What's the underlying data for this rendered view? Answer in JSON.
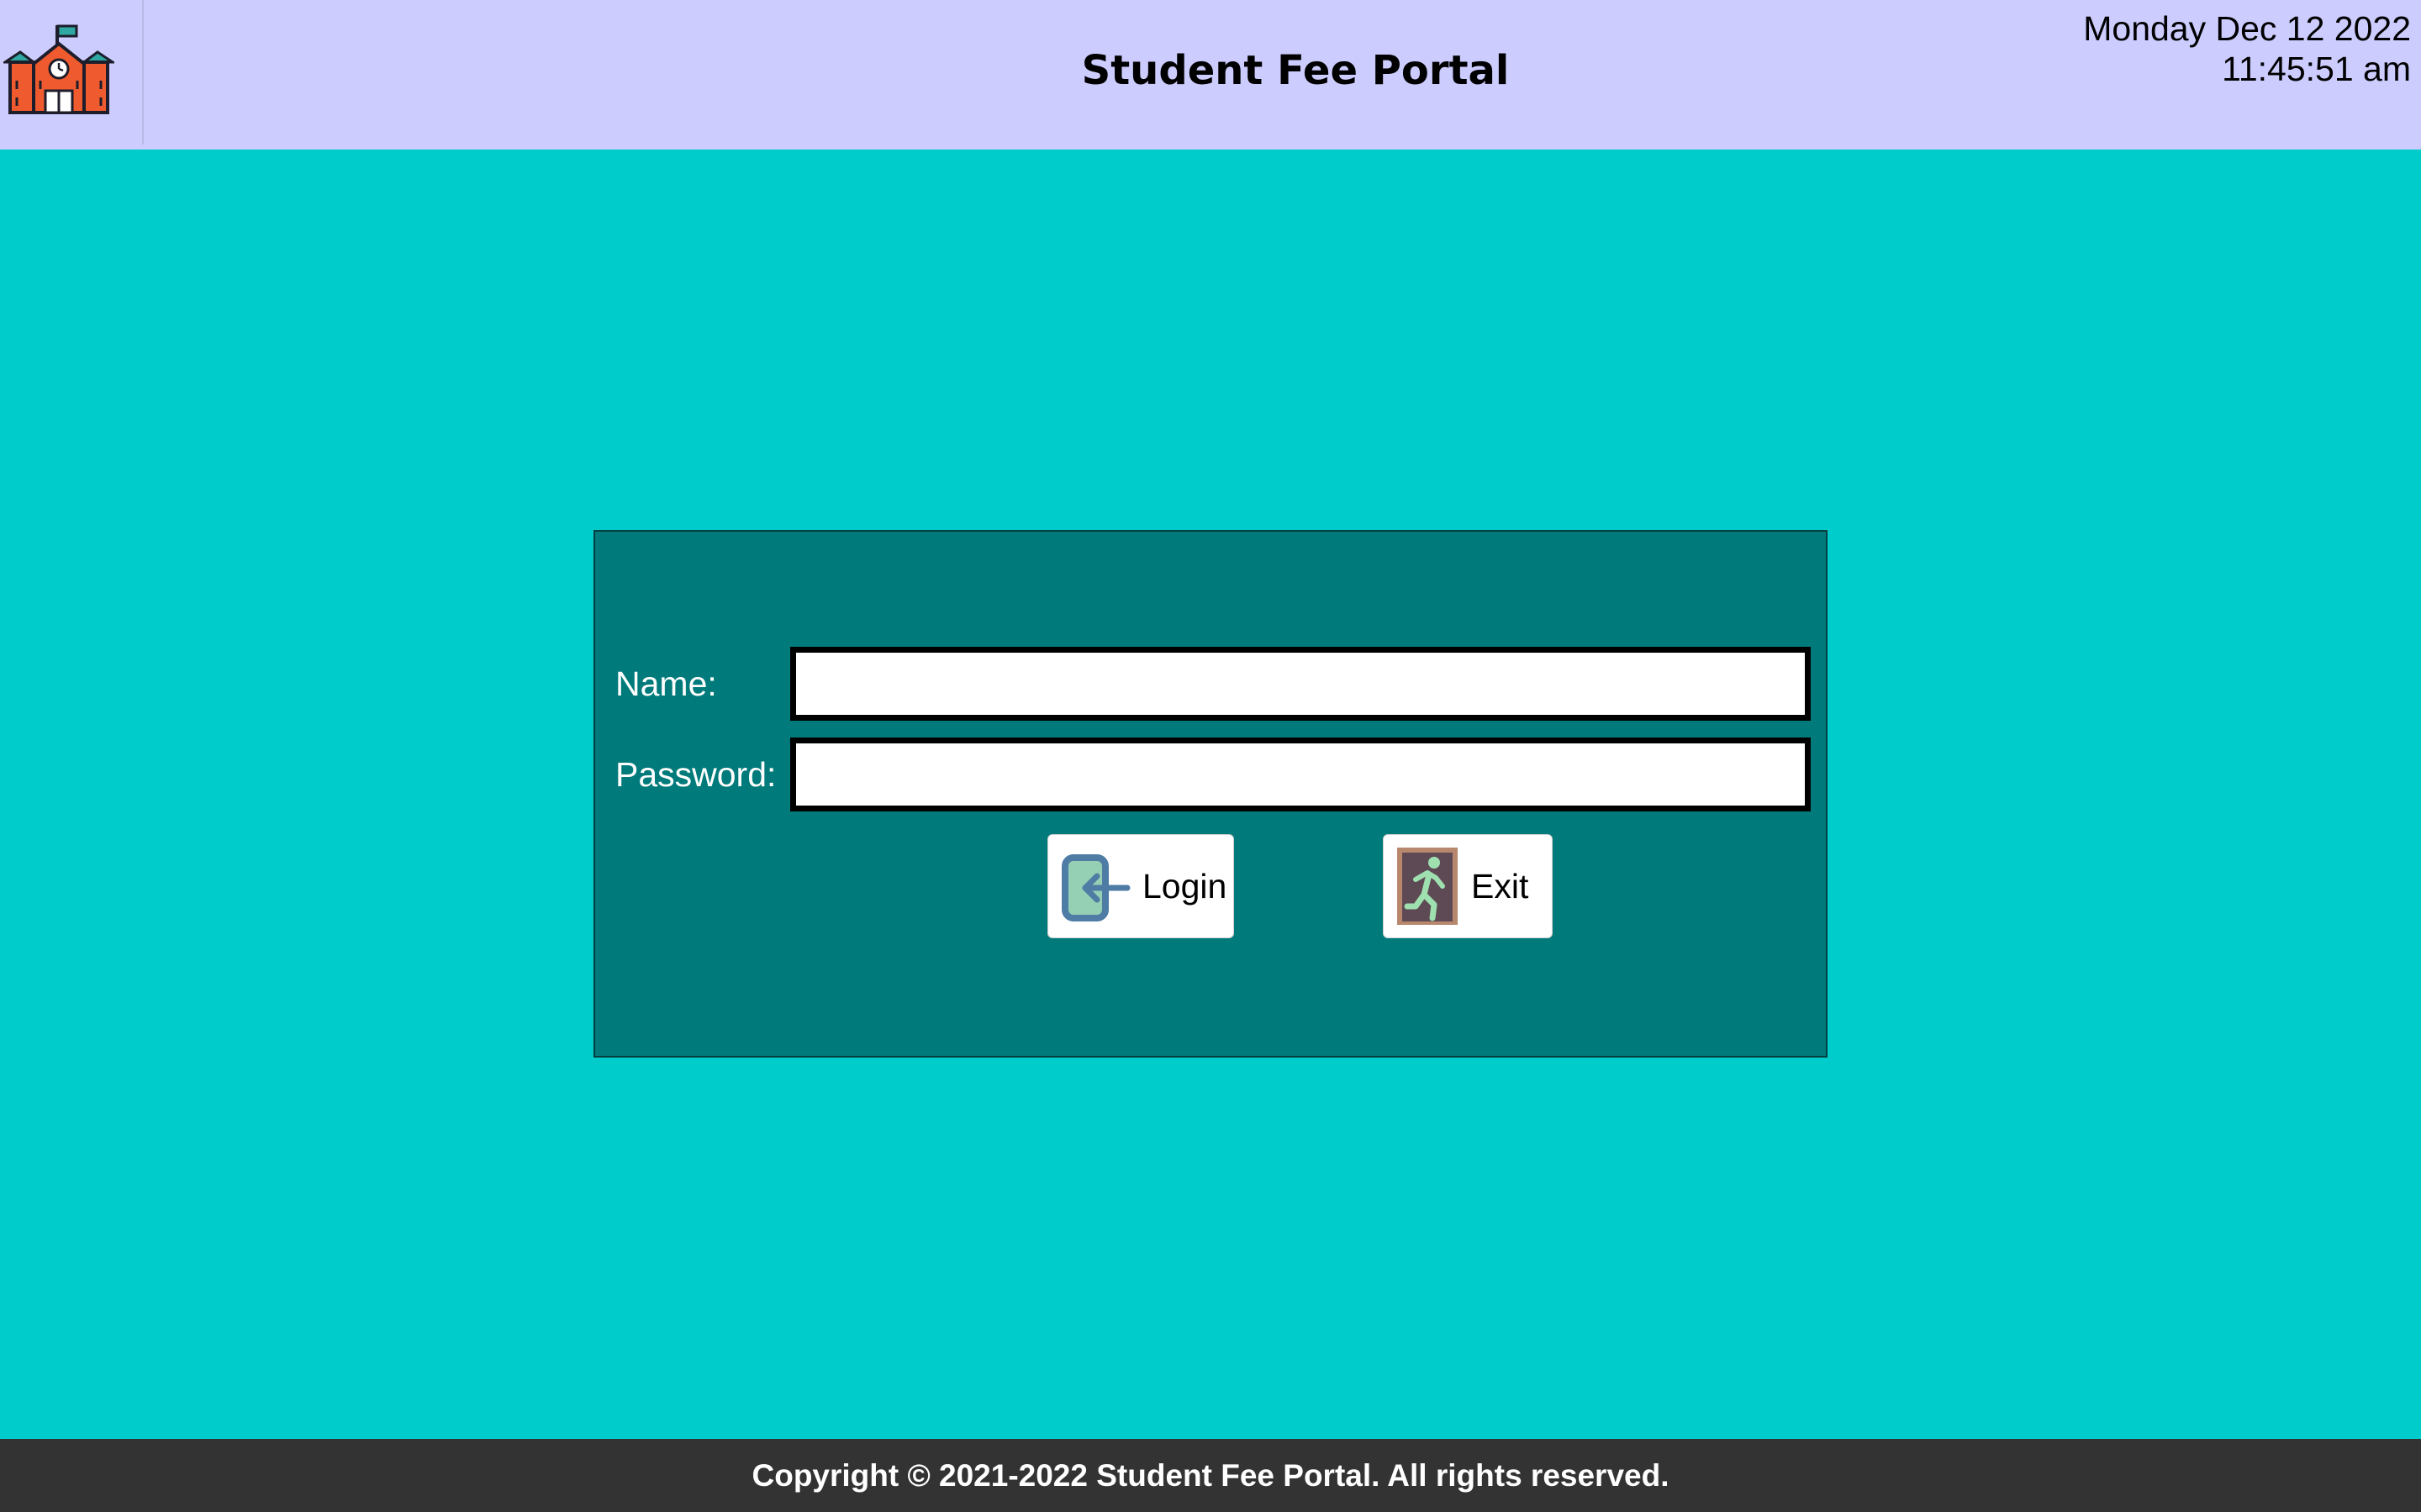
{
  "header": {
    "title": "Student Fee Portal",
    "date": "Monday Dec 12 2022",
    "time": "11:45:51 am",
    "logo_icon": "school-building-icon",
    "background": "#ccccff"
  },
  "login_form": {
    "name_label": "Name:",
    "name_value": "",
    "password_label": "Password:",
    "password_value": "",
    "panel_color": "#007a7a",
    "buttons": {
      "login": {
        "label": "Login",
        "icon": "login-door-arrow-icon"
      },
      "exit": {
        "label": "Exit",
        "icon": "emergency-exit-icon"
      }
    }
  },
  "footer": {
    "copyright": "Copyright © 2021-2022 Student Fee Portal. All rights reserved.",
    "background": "#333333"
  },
  "page": {
    "background": "#00cccc"
  }
}
